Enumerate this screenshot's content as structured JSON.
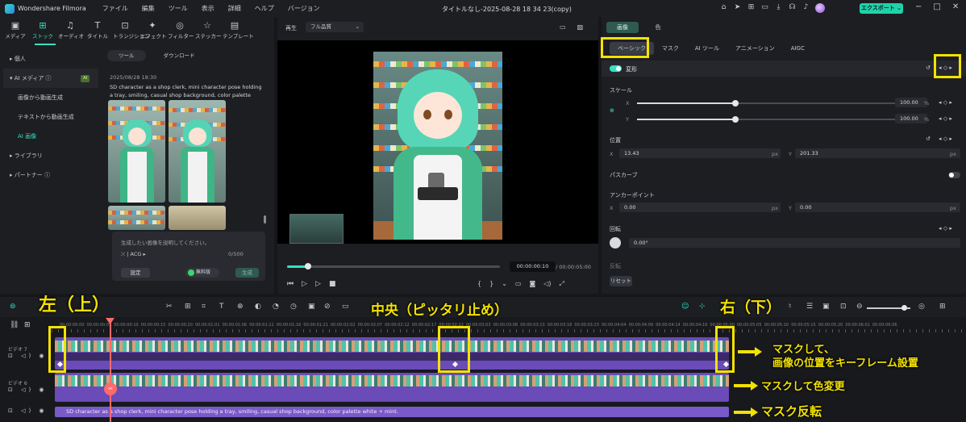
{
  "titlebar": {
    "app_name": "Wondershare Filmora",
    "menu": [
      "ファイル",
      "編集",
      "ツール",
      "表示",
      "詳細",
      "ヘルプ",
      "バージョン"
    ],
    "doc_title": "タイトルなし-2025-08-28 18 34 23(copy)",
    "export_label": "エクスポート ⌄",
    "icons": [
      "gift-icon",
      "send-icon",
      "grid-icon",
      "monitor-icon",
      "download-icon",
      "headset-icon",
      "bell-icon",
      "user-avatar"
    ]
  },
  "media": {
    "tabs": [
      {
        "icon": "▣",
        "label": "メディア"
      },
      {
        "icon": "⊞",
        "label": "ストック"
      },
      {
        "icon": "♫",
        "label": "オーディオ"
      },
      {
        "icon": "T",
        "label": "タイトル"
      },
      {
        "icon": "⊡",
        "label": "トランジション"
      },
      {
        "icon": "✦",
        "label": "エフェクト"
      },
      {
        "icon": "◎",
        "label": "フィルター"
      },
      {
        "icon": "☆",
        "label": "ステッカー"
      },
      {
        "icon": "▤",
        "label": "テンプレート"
      }
    ],
    "nav": [
      {
        "label": "▸ 個人",
        "sub": false
      },
      {
        "label": "▾ AI メディア ⓘ",
        "sub": false,
        "badge": "AI"
      },
      {
        "label": "画像から動画生成",
        "sub": true
      },
      {
        "label": "テキストから動画生成",
        "sub": true
      },
      {
        "label": "AI 画像",
        "sub": true,
        "active": true
      },
      {
        "label": "▸ ライブラリ",
        "sub": false
      },
      {
        "label": "▸ パートナー ⓘ",
        "sub": false
      }
    ],
    "sub_tabs": [
      "ツール",
      "ダウンロード"
    ],
    "gen_date": "2025/08/28 18:30",
    "prompt": "SD character as a shop clerk, mini character pose holding a tray, smiling, casual shop background, color palette white...",
    "prompt_placeholder": "生成したい画像を説明してください。",
    "style_option": "⤫ | ACG ▸",
    "char_count": "0/500",
    "settings_label": "設定",
    "free_label": "無料版",
    "generate_label": "生成"
  },
  "preview": {
    "label": "再生",
    "quality": "フル品質",
    "current_time": "00:00:00:10",
    "total_time": "/  00:00:05:00",
    "progress": 0.1
  },
  "props": {
    "top_tabs": [
      "画像",
      "色"
    ],
    "sub_tabs": [
      "ベーシック",
      "マスク",
      "AI ツール",
      "アニメーション",
      "AIGC"
    ],
    "transform_label": "変形",
    "scale_label": "スケール",
    "scale_x": "100.00",
    "scale_y": "100.00",
    "scale_unit": "%",
    "scale_fraction": 0.38,
    "position_label": "位置",
    "pos_x": "13.43",
    "pos_y": "201.33",
    "path_curve_label": "パスカーブ",
    "anchor_label": "アンカーポイント",
    "anchor_x": "0.00",
    "anchor_y": "0.00",
    "rotate_label": "回転",
    "rotate_value": "0.00°",
    "flip_label": "反転",
    "px": "px",
    "x": "X",
    "y": "Y",
    "reset_label": "リセット",
    "kf_nav": "◂ ◇ ▸"
  },
  "timeline": {
    "ruler_labels": [
      "00:00:00:00",
      "00:00:00:05",
      "00:00:00:10",
      "00:00:00:15",
      "00:00:00:20",
      "00:00:01:01",
      "00:00:01:06",
      "00:00:01:11",
      "00:00:01:16",
      "00:00:01:21",
      "00:00:02:02",
      "00:00:02:07",
      "00:00:02:12",
      "00:00:02:17",
      "00:00:02:22",
      "00:00:03:03",
      "00:00:03:08",
      "00:00:03:13",
      "00:00:03:18",
      "00:00:03:23",
      "00:00:04:04",
      "00:00:04:09",
      "00:00:04:14",
      "00:00:04:19",
      "00:00:05:00",
      "00:00:05:05",
      "00:00:05:10",
      "00:00:05:15",
      "00:00:05:20",
      "00:00:06:01",
      "00:00:06:06"
    ],
    "track7_label": "ビデオ 7",
    "track6_label": "ビデオ 6",
    "track_icons": "⊡ ◁) ◉",
    "text_clip": "SD character as a shop clerk, mini character pose holding a tray, smiling, casual shop background, color palette white + mint."
  },
  "annotations": {
    "left": "左（上）",
    "center": "中央（ピッタリ止め）",
    "right": "右（下）",
    "note1_line1": "マスクして、",
    "note1_line2": "画像の位置をキーフレーム設置",
    "note2": "マスクして色変更",
    "note3": "マスク反転",
    "highlight_color": "#f3e200"
  },
  "colors": {
    "accent": "#37e0c2",
    "clip": "#6a4bb8",
    "playhead": "#ff6a6a"
  }
}
